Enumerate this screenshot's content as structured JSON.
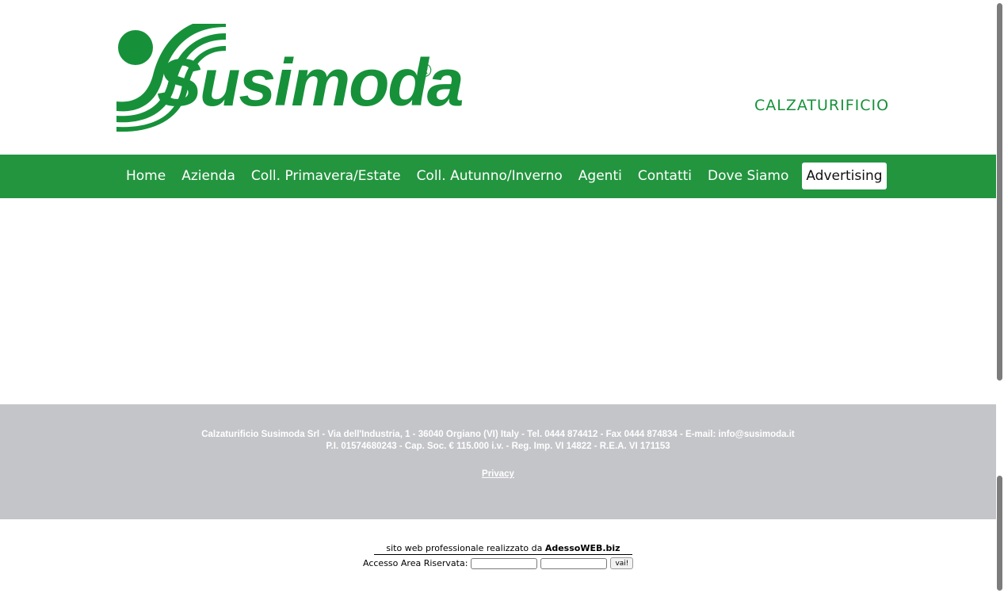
{
  "brand": {
    "name": "Susimoda",
    "registered_mark": "®",
    "tagline": "CALZATURIFICIO",
    "color": "#16913a"
  },
  "nav": {
    "items": [
      {
        "label": "Home"
      },
      {
        "label": "Azienda"
      },
      {
        "label": "Coll. Primavera/Estate"
      },
      {
        "label": "Coll. Autunno/Inverno"
      },
      {
        "label": "Agenti"
      },
      {
        "label": "Contatti"
      },
      {
        "label": "Dove Siamo"
      },
      {
        "label": "Advertising"
      }
    ],
    "active": "Advertising",
    "background": "#23953f"
  },
  "footer": {
    "line1": "Calzaturificio Susimoda Srl - Via dell'Industria, 1 - 36040 Orgiano (VI) Italy - Tel. 0444 874412 - Fax 0444 874834 - E-mail: info@susimoda.it",
    "line2": "P.I. 01574680243 - Cap. Soc. € 115.000 i.v. - Reg. Imp. VI 14822 - R.E.A. VI 171153",
    "privacy_label": "Privacy",
    "background": "#c4c5c9"
  },
  "credit": {
    "prefix": "sito web professionale realizzato da ",
    "company": "AdessoWEB.biz"
  },
  "login": {
    "label": "Accesso Area Riservata:",
    "username_value": "",
    "password_value": "",
    "submit_label": "vai!"
  }
}
